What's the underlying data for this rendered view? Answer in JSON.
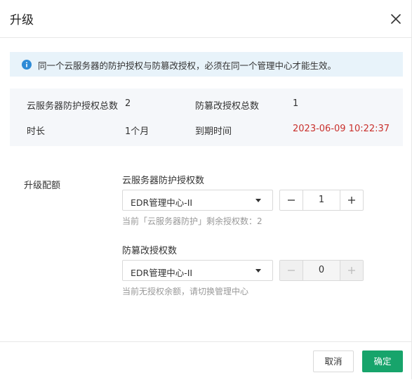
{
  "dialog": {
    "title": "升级"
  },
  "alert": {
    "message": "同一个云服务器的防护授权与防篡改授权，必须在同一个管理中心才能生效。"
  },
  "summary": {
    "server_total_label": "云服务器防护授权总数",
    "server_total_value": "2",
    "tamper_total_label": "防篡改授权总数",
    "tamper_total_value": "1",
    "duration_label": "时长",
    "duration_value": "1个月",
    "expiry_label": "到期时间",
    "expiry_value": "2023-06-09 10:22:37"
  },
  "upgrade": {
    "section_label": "升级配额",
    "server": {
      "label": "云服务器防护授权数",
      "select_value": "EDR管理中心-II",
      "quantity": "1",
      "hint": "当前「云服务器防护」剩余授权数：2"
    },
    "tamper": {
      "label": "防篡改授权数",
      "select_value": "EDR管理中心-II",
      "quantity": "0",
      "hint": "当前无授权余额，请切换管理中心"
    }
  },
  "footer": {
    "cancel_label": "取消",
    "ok_label": "确定"
  },
  "colors": {
    "primary": "#17a46b",
    "alert_bg": "#e8f3fa",
    "info_icon": "#2e8bd6",
    "expiry": "#c9302c"
  },
  "icons": {
    "close": "close-icon",
    "info": "info-icon",
    "dropdown": "chevron-down-icon",
    "minus": "minus-icon",
    "plus": "plus-icon"
  }
}
